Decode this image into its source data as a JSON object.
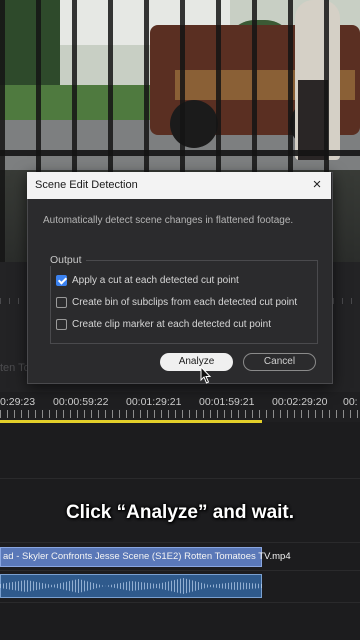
{
  "dialog": {
    "title": "Scene Edit Detection",
    "close_glyph": "×",
    "description": "Automatically detect scene changes in flattened footage.",
    "output_label": "Output",
    "options": [
      {
        "label": "Apply a cut at each detected cut point",
        "checked": true
      },
      {
        "label": "Create bin of subclips from each detected cut point",
        "checked": false
      },
      {
        "label": "Create clip marker at each detected cut point",
        "checked": false
      }
    ],
    "analyze_label": "Analyze",
    "cancel_label": "Cancel"
  },
  "timeline": {
    "timecodes": [
      "0:29:23",
      "00:00:59:22",
      "00:01:29:21",
      "00:01:59:21",
      "00:02:29:20",
      "00:"
    ],
    "video_clip_name": "ad - Skyler Confronts Jesse Scene (S1E2)   Rotten Tomatoes TV.mp4",
    "faint_label": "ten To"
  },
  "caption": "Click “Analyze” and wait.",
  "colors": {
    "accent_checkbox": "#3b82f0",
    "work_area_bar": "#e3cf2a",
    "video_clip": "#5a78b8",
    "audio_clip": "#2f5a8c"
  },
  "icons": [
    "close-icon",
    "checkmark-icon",
    "mouse-cursor-icon"
  ]
}
